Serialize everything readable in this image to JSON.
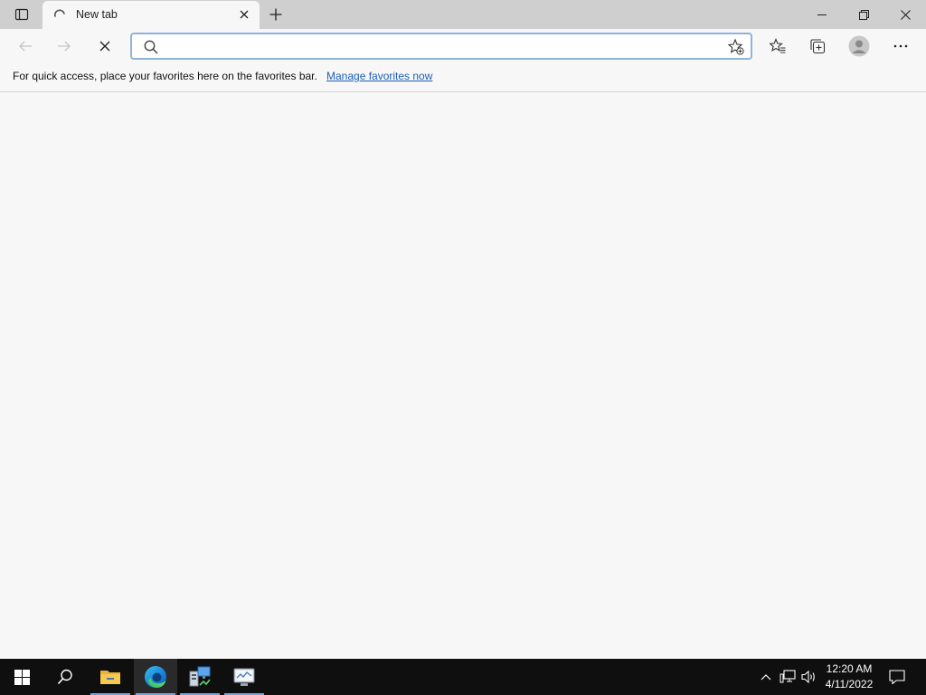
{
  "browser": {
    "tab": {
      "title": "New tab"
    },
    "addressbar": {
      "value": "",
      "placeholder": ""
    },
    "favorites_bar": {
      "message": "For quick access, place your favorites here on the favorites bar.",
      "link_text": "Manage favorites now"
    }
  },
  "icons": {
    "tab_actions": "tab-actions-icon",
    "loading": "loading-spinner-icon",
    "close_tab": "close-icon",
    "new_tab": "plus-icon",
    "minimize": "minimize-icon",
    "restore": "restore-icon",
    "close_window": "close-icon",
    "back": "back-arrow-icon",
    "forward": "forward-arrow-icon",
    "stop": "stop-icon",
    "search": "search-icon",
    "add_favorite": "star-add-icon",
    "favorites": "favorites-icon",
    "collections": "collections-icon",
    "profile": "profile-icon",
    "menu": "more-icon"
  },
  "taskbar": {
    "apps": [
      "start",
      "search",
      "file-explorer",
      "edge",
      "server-manager",
      "network-app"
    ],
    "clock": {
      "time": "12:20 AM",
      "date": "4/11/2022"
    }
  },
  "colors": {
    "accent": "#1a5fb4",
    "tabstrip": "#cfcfcf",
    "page_bg": "#f7f7f7",
    "taskbar_bg": "#0f0f0f"
  }
}
